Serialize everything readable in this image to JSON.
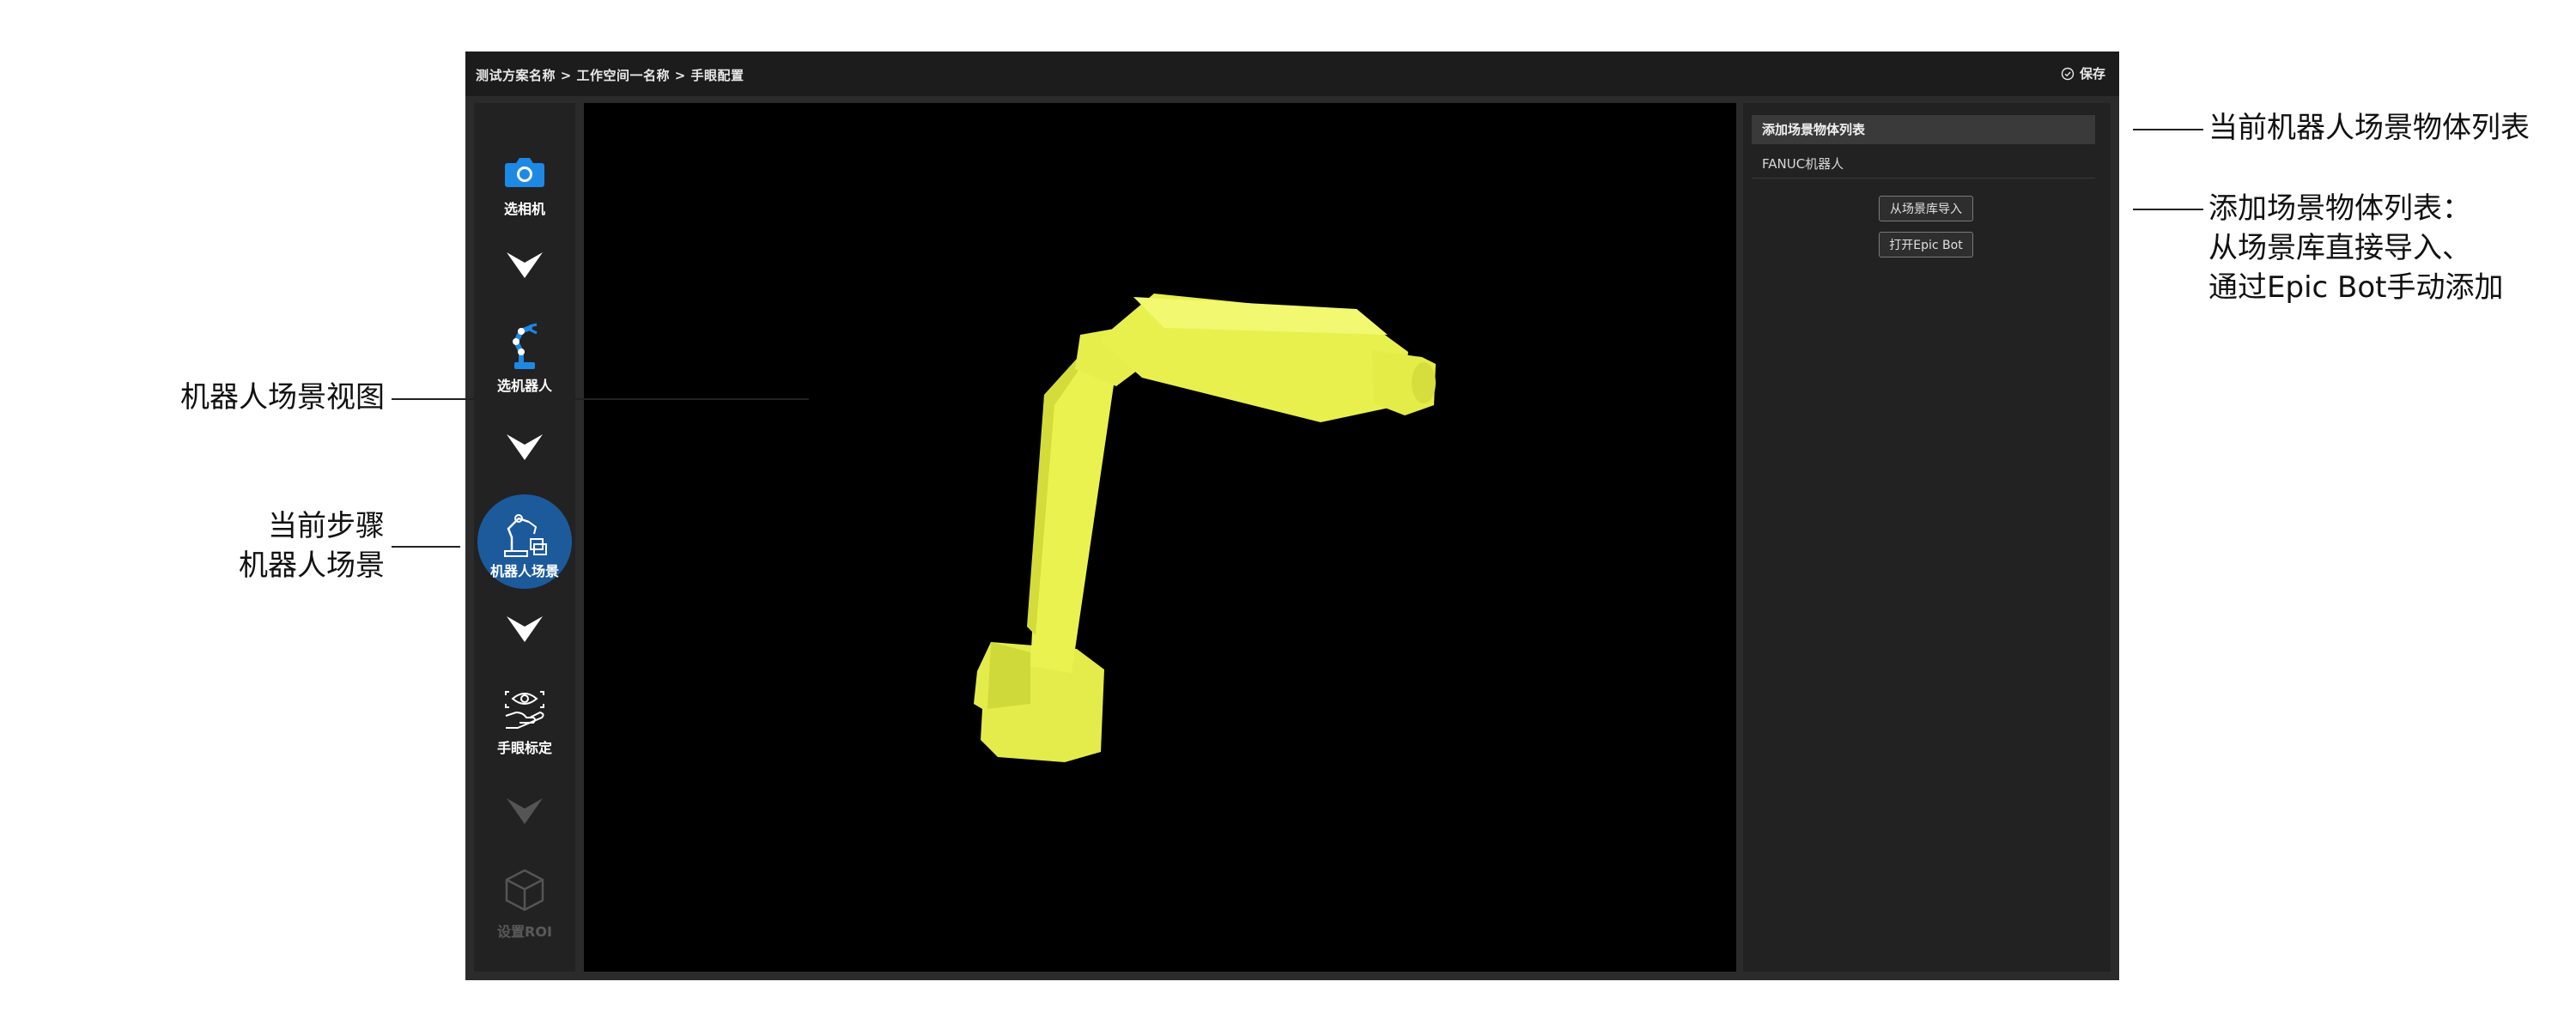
{
  "topbar": {
    "breadcrumb": "测试方案名称 > 工作空间一名称 > 手眼配置",
    "save_label": "保存"
  },
  "sidebar": {
    "steps": [
      {
        "label": "选相机",
        "icon": "camera-icon",
        "state": "done"
      },
      {
        "label": "选机器人",
        "icon": "robot-arm-icon",
        "state": "done"
      },
      {
        "label": "机器人场景",
        "icon": "robot-scene-icon",
        "state": "active"
      },
      {
        "label": "手眼标定",
        "icon": "hand-eye-icon",
        "state": "pending"
      },
      {
        "label": "设置ROI",
        "icon": "cube-icon",
        "state": "disabled"
      }
    ],
    "active_color": "#1c5a9c"
  },
  "right_panel": {
    "header": "添加场景物体列表",
    "items": [
      "FANUC机器人"
    ],
    "import_button": "从场景库导入",
    "epicbot_button": "打开Epic Bot"
  },
  "viewport": {
    "object_color": "#e8f050"
  },
  "annotations": {
    "scene_list": "当前机器人场景物体列表",
    "add_list_lines": [
      "添加场景物体列表：",
      "从场景库直接导入、",
      "通过Epic Bot手动添加"
    ],
    "scene_view": "机器人场景视图",
    "current_step_lines": [
      "当前步骤",
      "机器人场景"
    ]
  }
}
